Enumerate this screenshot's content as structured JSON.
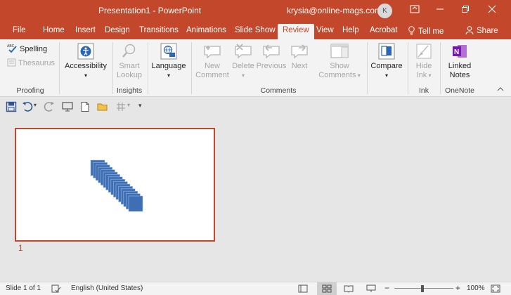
{
  "titlebar": {
    "title": "Presentation1  -  PowerPoint",
    "account": "krysia@online-mags.com",
    "avatar_initial": "K"
  },
  "tabs": [
    "File",
    "Home",
    "Insert",
    "Design",
    "Transitions",
    "Animations",
    "Slide Show",
    "Review",
    "View",
    "Help",
    "Acrobat",
    "Tell me",
    "Share"
  ],
  "active_tab": "Review",
  "ribbon": {
    "proofing": {
      "spelling": "Spelling",
      "thesaurus": "Thesaurus",
      "label": "Proofing"
    },
    "accessibility": {
      "label": "Accessibility"
    },
    "insights": {
      "smart": "Smart",
      "lookup": "Lookup",
      "label": "Insights"
    },
    "language": {
      "label": "Language"
    },
    "comments": {
      "new1": "New",
      "new2": "Comment",
      "delete": "Delete",
      "previous": "Previous",
      "next": "Next",
      "show1": "Show",
      "show2": "Comments",
      "label": "Comments"
    },
    "compare": {
      "label": "Compare"
    },
    "ink": {
      "hide1": "Hide",
      "hide2": "Ink",
      "label": "Ink"
    },
    "onenote": {
      "linked1": "Linked",
      "linked2": "Notes",
      "label": "OneNote"
    }
  },
  "slide": {
    "number": "1"
  },
  "status": {
    "slide_of": "Slide 1 of 1",
    "language": "English (United States)",
    "zoom": "100%"
  },
  "colors": {
    "accent": "#c3482b",
    "thumbnail_shape": "#3e6fb5"
  },
  "icons": [
    "spelling-icon",
    "thesaurus-icon",
    "accessibility-icon",
    "smart-lookup-icon",
    "language-icon",
    "new-comment-icon",
    "delete-comment-icon",
    "previous-comment-icon",
    "next-comment-icon",
    "show-comments-icon",
    "compare-icon",
    "hide-ink-icon",
    "onenote-icon",
    "save-icon",
    "undo-icon",
    "redo-icon",
    "from-beginning-icon",
    "new-file-icon",
    "open-icon",
    "tell-me-icon",
    "share-icon"
  ]
}
